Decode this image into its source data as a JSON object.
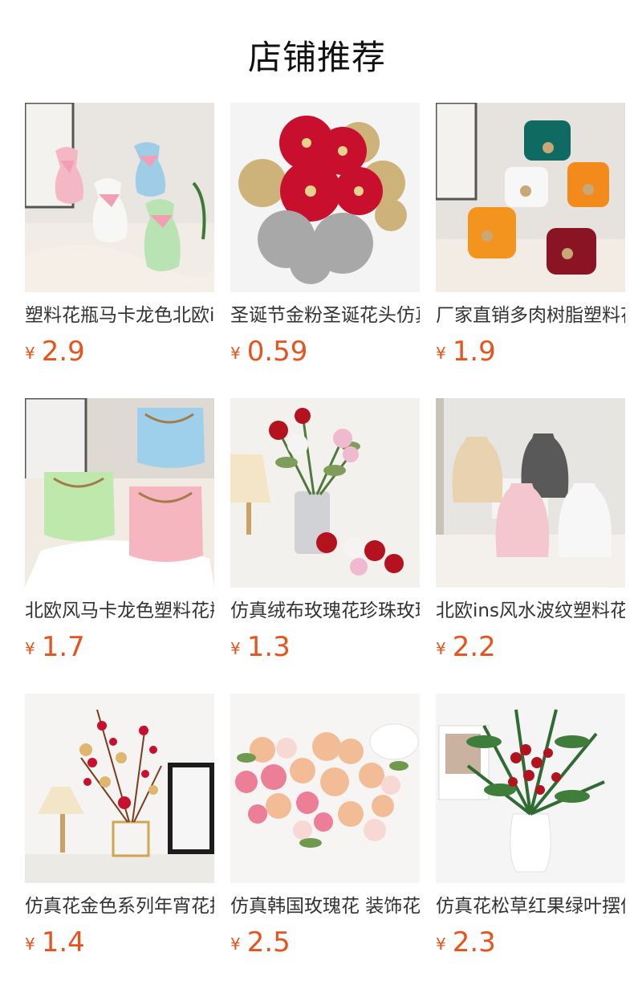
{
  "header": {
    "title": "店铺推荐"
  },
  "currency_symbol": "¥",
  "products": [
    {
      "name": "塑料花瓶马卡龙色北欧ins风",
      "price": "2.9",
      "image_icon": "pastel-vases-image"
    },
    {
      "name": "圣诞节金粉圣诞花头仿真花",
      "price": "0.59",
      "image_icon": "christmas-poinsettia-image"
    },
    {
      "name": "厂家直销多肉树脂塑料花盆",
      "price": "1.9",
      "image_icon": "colorful-pots-image"
    },
    {
      "name": "北欧风马卡龙色塑料花瓶",
      "price": "1.7",
      "image_icon": "macaron-vases-image"
    },
    {
      "name": "仿真绒布玫瑰花珍珠玫瑰",
      "price": "1.3",
      "image_icon": "velvet-roses-image"
    },
    {
      "name": "北欧ins风水波纹塑料花瓶",
      "price": "2.2",
      "image_icon": "wave-vases-image"
    },
    {
      "name": "仿真花金色系列年宵花摆件",
      "price": "1.4",
      "image_icon": "golden-spring-flowers-image"
    },
    {
      "name": "仿真韩国玫瑰花 装饰花束",
      "price": "2.5",
      "image_icon": "korean-rose-bouquet-image"
    },
    {
      "name": "仿真花松草红果绿叶摆件",
      "price": "2.3",
      "image_icon": "pine-berry-arrangement-image"
    }
  ],
  "colors": {
    "price": "#e8521c",
    "title": "#111111",
    "name": "#333333"
  }
}
